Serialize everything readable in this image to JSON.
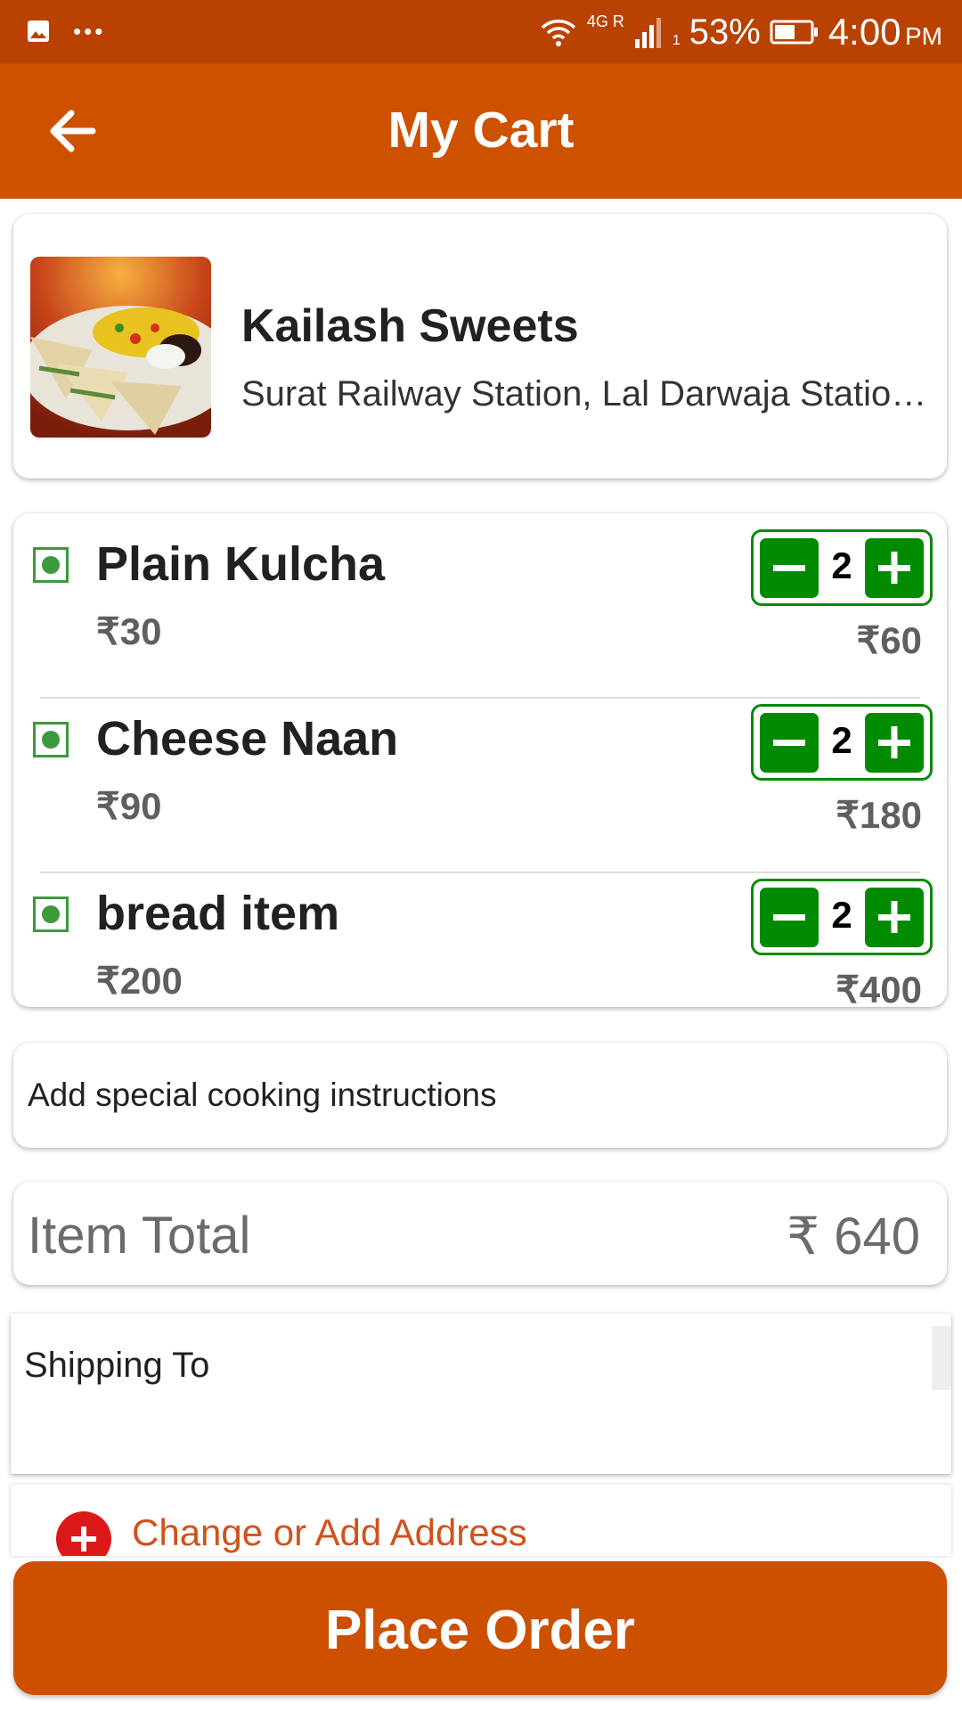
{
  "status_bar": {
    "network": "4G R",
    "sim": "1",
    "battery": "53%",
    "time": "4:00",
    "ampm": "PM",
    "icons": [
      "gallery-icon",
      "more-dots-icon",
      "wifi-icon",
      "signal-icon",
      "battery-icon"
    ]
  },
  "app_bar": {
    "title": "My Cart",
    "back_icon": "arrow-left-icon",
    "color": "#CE5100"
  },
  "restaurant": {
    "name": "Kailash Sweets",
    "address": "Surat Railway Station, Lal Darwaja Station Road"
  },
  "items": [
    {
      "name": "Plain Kulcha",
      "price": "₹30",
      "quantity": "2",
      "total": "₹60",
      "veg": true
    },
    {
      "name": "Cheese Naan",
      "price": "₹90",
      "quantity": "2",
      "total": "₹180",
      "veg": true
    },
    {
      "name": "bread item",
      "price": "₹200",
      "quantity": "2",
      "total": "₹400",
      "veg": true
    }
  ],
  "instructions": {
    "label": "Add special cooking instructions"
  },
  "summary": {
    "label": "Item Total",
    "value": "₹ 640"
  },
  "shipping": {
    "title": "Shipping To",
    "change_label": "Change or Add Address"
  },
  "place_order": {
    "label": "Place Order"
  },
  "colors": {
    "primary": "#CE5100",
    "status_bar": "#B94200",
    "stepper_green": "#008A00",
    "veg_green": "#3C9A3C",
    "add_red": "#DD1818"
  }
}
